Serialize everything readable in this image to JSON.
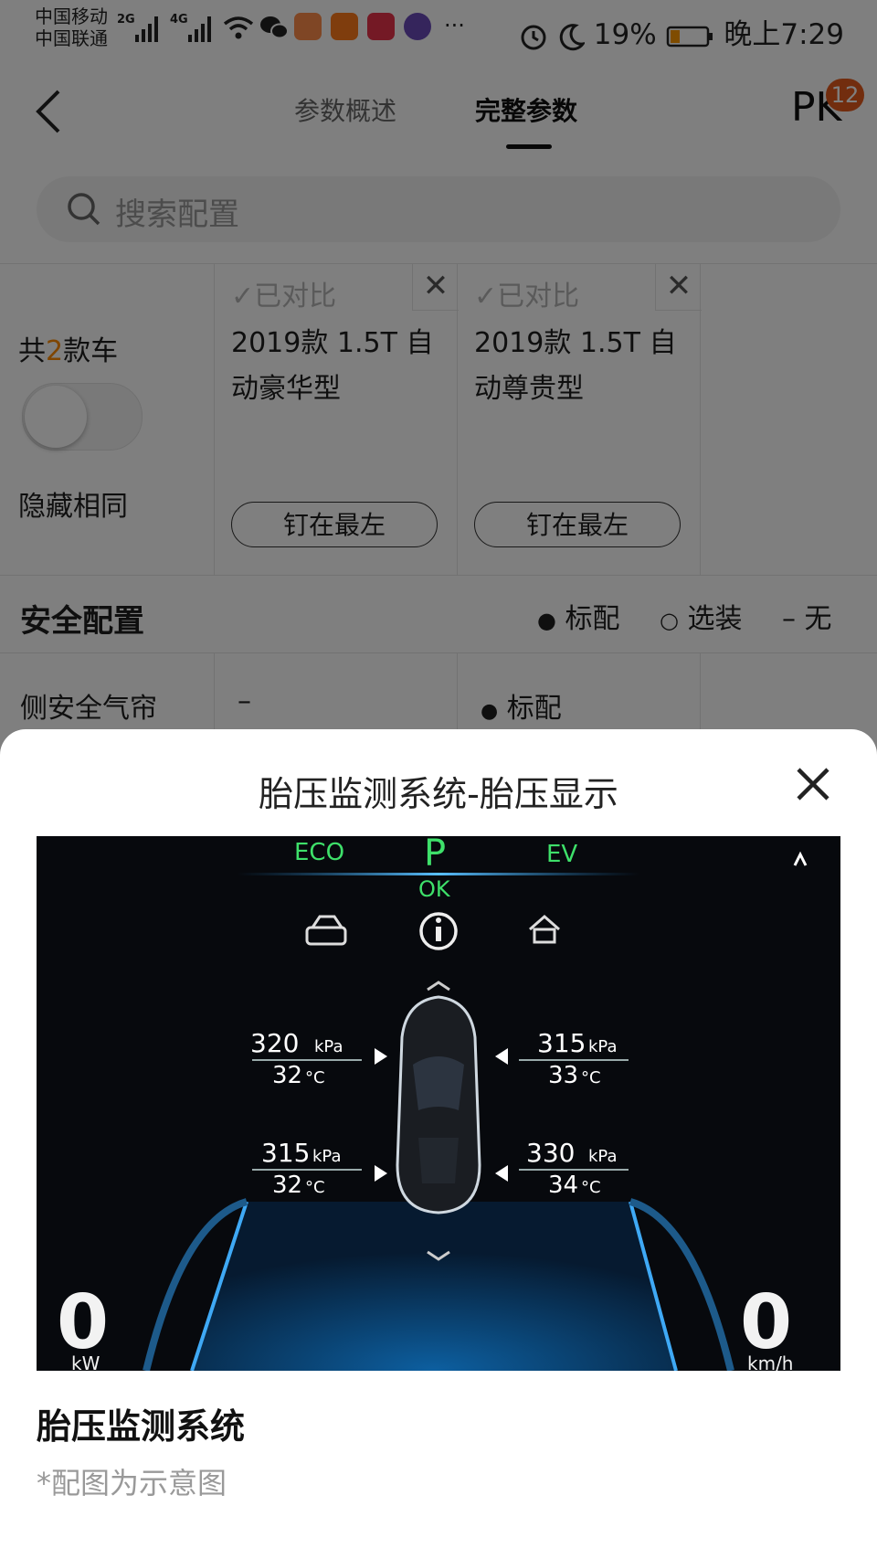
{
  "status_bar": {
    "carrier1": "中国移动",
    "carrier2": "中国联通",
    "net1": "2G",
    "net2": "4G",
    "battery": "19%",
    "time": "晚上7:29",
    "more": "···"
  },
  "nav": {
    "tab_overview": "参数概述",
    "tab_full": "完整参数",
    "pk_label": "PK",
    "pk_badge": "12"
  },
  "search": {
    "placeholder": "搜索配置"
  },
  "compare": {
    "count_prefix": "共",
    "count": "2",
    "count_suffix": "款车",
    "hide_same": "隐藏相同",
    "cars": [
      {
        "status": "已对比",
        "name": "2019款 1.5T 自动豪华型",
        "pin": "钉在最左"
      },
      {
        "status": "已对比",
        "name": "2019款 1.5T 自动尊贵型",
        "pin": "钉在最左"
      }
    ]
  },
  "section": {
    "title": "安全配置",
    "legend_standard": "标配",
    "legend_optional": "选装",
    "legend_none": "无",
    "row_label": "侧安全气帘",
    "row_val1": "–",
    "row_val2": "标配"
  },
  "sheet": {
    "title": "胎压监测系统-胎压显示",
    "caption_title": "胎压监测系统",
    "caption_note": "*配图为示意图"
  },
  "dashboard": {
    "eco": "ECO",
    "gear": "P",
    "ok": "OK",
    "ev": "EV",
    "fl_pressure": "320",
    "fl_temp": "32",
    "fr_pressure": "315",
    "fr_temp": "33",
    "rl_pressure": "315",
    "rl_temp": "32",
    "rr_pressure": "330",
    "rr_temp": "34",
    "unit_pressure": "kPa",
    "unit_temp": "°C",
    "left_gauge": "0",
    "left_unit": "kW",
    "right_gauge": "0",
    "right_unit": "km/h"
  },
  "colors": {
    "accent": "#ff8a00",
    "badge": "#e55a1c"
  }
}
